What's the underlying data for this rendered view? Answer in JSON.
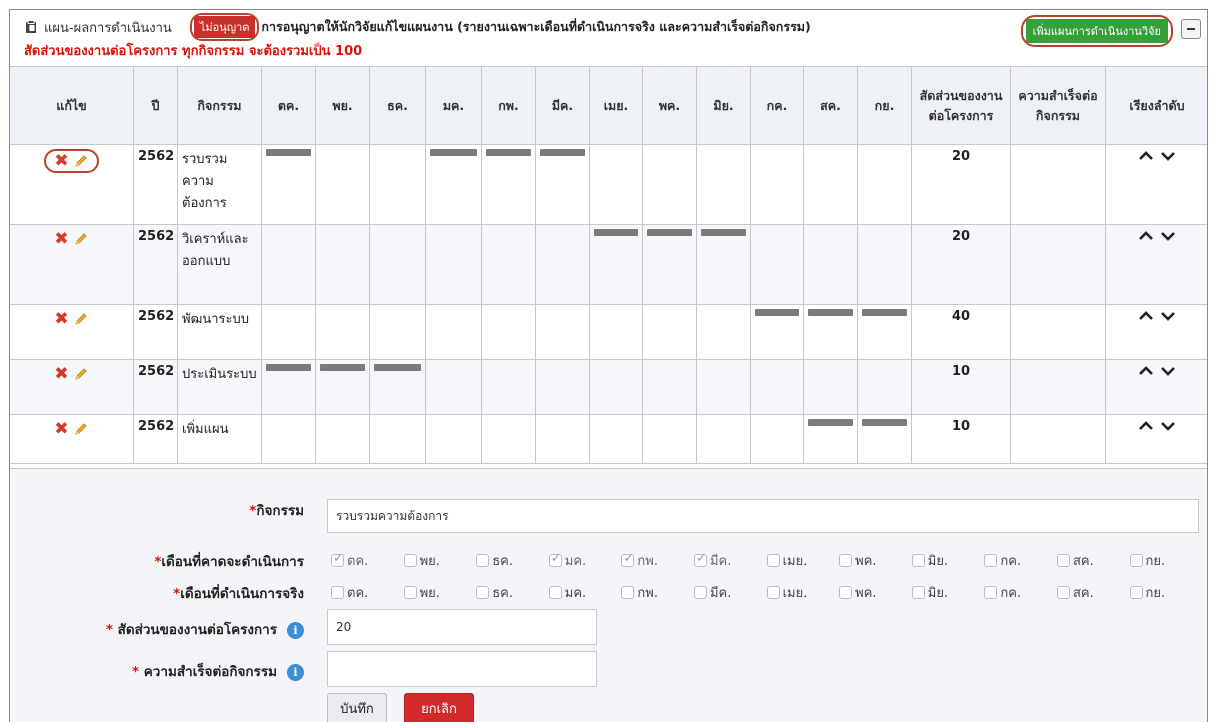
{
  "header": {
    "title": "แผน-ผลการดำเนินงาน",
    "badge": "ไม่อนุญาต",
    "description": "การอนุญาตให้นักวิจัยแก้ไขแผนงาน (รายงานเฉพาะเดือนที่ดำเนินการจริง และความสำเร็จต่อกิจกรรม)",
    "notice": "สัดส่วนของงานต่อโครงการ ทุกกิจกรรม จะต้องรวมเป็น 100",
    "add_button": "เพิ่มแผนการดำเนินงานวิจัย"
  },
  "table": {
    "headers": {
      "edit": "แก้ไข",
      "year": "ปี",
      "activity": "กิจกรรม",
      "ratio": "สัดส่วนของงานต่อโครงการ",
      "success": "ความสำเร็จต่อกิจกรรม",
      "sort": "เรียงลำดับ"
    },
    "months": [
      "ตค.",
      "พย.",
      "ธค.",
      "มค.",
      "กพ.",
      "มีค.",
      "เมย.",
      "พค.",
      "มิย.",
      "กค.",
      "สค.",
      "กย."
    ],
    "rows": [
      {
        "year": "2562",
        "activity": "รวบรวมความต้องการ",
        "plan": [
          1,
          0,
          0,
          1,
          1,
          1,
          0,
          0,
          0,
          0,
          0,
          0
        ],
        "ratio": "20",
        "success": ""
      },
      {
        "year": "2562",
        "activity": "วิเคราห์และออกแบบ",
        "plan": [
          0,
          0,
          0,
          0,
          0,
          0,
          1,
          1,
          1,
          0,
          0,
          0
        ],
        "ratio": "20",
        "success": ""
      },
      {
        "year": "2562",
        "activity": "พัฒนาระบบ",
        "plan": [
          0,
          0,
          0,
          0,
          0,
          0,
          0,
          0,
          0,
          1,
          1,
          1
        ],
        "ratio": "40",
        "success": ""
      },
      {
        "year": "2562",
        "activity": "ประเมินระบบ",
        "plan": [
          1,
          1,
          1,
          0,
          0,
          0,
          0,
          0,
          0,
          0,
          0,
          0
        ],
        "ratio": "10",
        "success": ""
      },
      {
        "year": "2562",
        "activity": "เพิ่มแผน",
        "plan": [
          0,
          0,
          0,
          0,
          0,
          0,
          0,
          0,
          0,
          0,
          1,
          1
        ],
        "ratio": "10",
        "success": ""
      }
    ]
  },
  "form": {
    "activity_label": "กิจกรรม",
    "activity_value": "รวบรวมความต้องการ",
    "planned_label": "เดือนที่คาดจะดำเนินการ",
    "planned_checked": [
      true,
      false,
      false,
      true,
      true,
      true,
      false,
      false,
      false,
      false,
      false,
      false
    ],
    "actual_label": "เดือนที่ดำเนินการจริง",
    "actual_checked": [
      false,
      false,
      false,
      false,
      false,
      false,
      false,
      false,
      false,
      false,
      false,
      false
    ],
    "ratio_label": " สัดส่วนของงานต่อโครงการ",
    "ratio_value": "20",
    "success_label": " ความสำเร็จต่อกิจกรรม",
    "success_value": "",
    "save_button": "บันทึก",
    "cancel_button": "ยกเลิก"
  },
  "colors": {
    "red": "#d9140a",
    "green": "#35a03a",
    "bar": "#7b7b7b",
    "header_bg": "#eef2f7"
  }
}
